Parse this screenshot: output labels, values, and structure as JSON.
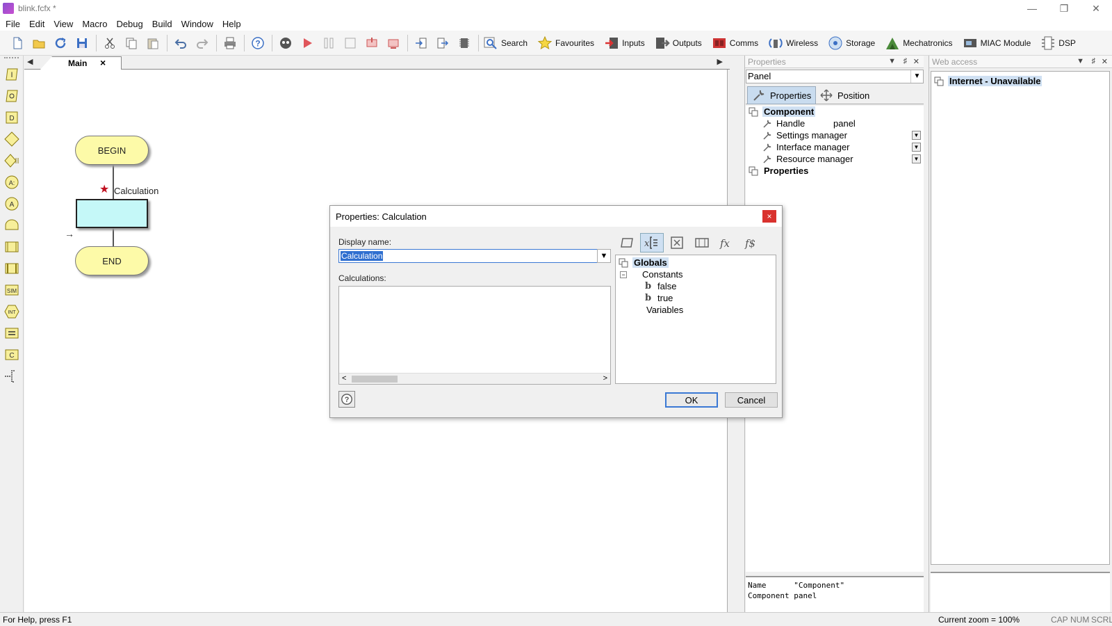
{
  "window": {
    "title": "blink.fcfx *",
    "controls": [
      "minimize",
      "restore",
      "close"
    ]
  },
  "menubar": {
    "items": [
      "File",
      "Edit",
      "View",
      "Macro",
      "Debug",
      "Build",
      "Window",
      "Help"
    ]
  },
  "toolbar": {
    "icon_buttons": [
      "new-icon",
      "open-icon",
      "refresh-icon",
      "save-icon",
      "cut-icon",
      "copy-icon",
      "paste-icon",
      "undo-icon",
      "redo-icon",
      "print-icon",
      "help-icon",
      "ghost-icon",
      "run-icon",
      "pause-icon",
      "stop-icon",
      "step-into-icon",
      "step-over-icon",
      "step-in-icon",
      "step-out-icon",
      "chip-icon"
    ],
    "labeled_buttons": [
      {
        "label": "Search",
        "icon": "search-icon"
      },
      {
        "label": "Favourites",
        "icon": "star-icon"
      },
      {
        "label": "Inputs",
        "icon": "inputs-icon"
      },
      {
        "label": "Outputs",
        "icon": "outputs-icon"
      },
      {
        "label": "Comms",
        "icon": "comms-icon"
      },
      {
        "label": "Wireless",
        "icon": "wireless-icon"
      },
      {
        "label": "Storage",
        "icon": "storage-icon"
      },
      {
        "label": "Mechatronics",
        "icon": "mechatronics-icon"
      },
      {
        "label": "MIAC Module",
        "icon": "miac-icon"
      },
      {
        "label": "DSP",
        "icon": "dsp-icon"
      }
    ]
  },
  "left_tools": [
    "input-icon",
    "output-icon",
    "delay-icon",
    "decision-icon",
    "switch-icon",
    "connection-point-icon",
    "connection-point-a-icon",
    "loop-icon",
    "macro-icon",
    "component-macro-icon",
    "simulation-icon",
    "interrupt-icon",
    "calculation-icon",
    "c-code-icon",
    "comment-icon"
  ],
  "doc_tabs": {
    "tabs": [
      {
        "label": "Main",
        "close": "×"
      }
    ]
  },
  "flowchart": {
    "begin_label": "BEGIN",
    "end_label": "END",
    "calc_label": "Calculation"
  },
  "properties_panel": {
    "title": "Properties",
    "combo_value": "Panel",
    "tabs": [
      "Properties",
      "Position"
    ],
    "component_cat": "Component",
    "rows": [
      {
        "label": "Handle",
        "value": "panel"
      },
      {
        "label": "Settings manager",
        "value": ""
      },
      {
        "label": "Interface manager",
        "value": ""
      },
      {
        "label": "Resource manager",
        "value": ""
      }
    ],
    "properties_cat": "Properties",
    "description": "Name      \"Component\"\nComponent panel"
  },
  "web_panel": {
    "title": "Web access",
    "status": "Internet - Unavailable"
  },
  "statusbar": {
    "help": "For Help, press F1",
    "zoom": "Current zoom = 100%",
    "indicators": [
      "CAP",
      "NUM",
      "SCRL"
    ]
  },
  "dialog": {
    "title": "Properties: Calculation",
    "close": "×",
    "display_name_label": "Display name:",
    "display_name_value": "Calculation",
    "calculations_label": "Calculations:",
    "tree": {
      "root": "Globals",
      "constants": "Constants",
      "const_items": [
        "false",
        "true"
      ],
      "variables": "Variables"
    },
    "ok": "OK",
    "cancel": "Cancel"
  },
  "colors": {
    "terminal_fill": "#fdfaa8",
    "calc_fill": "#c5f8f8",
    "selection": "#2f6fd0",
    "close_red": "#d9322e"
  }
}
